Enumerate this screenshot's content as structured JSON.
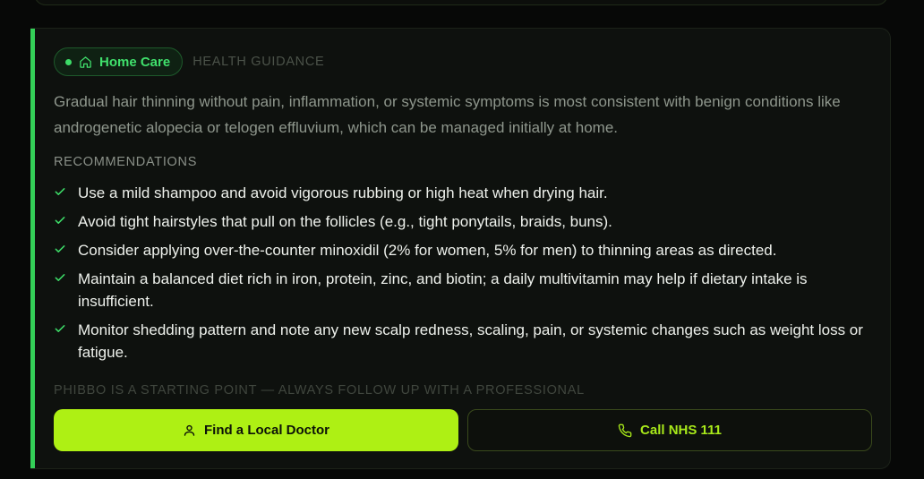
{
  "card": {
    "badge_label": "Home Care",
    "badge_icon": "home-icon",
    "eyebrow": "HEALTH GUIDANCE",
    "summary": "Gradual hair thinning without pain, inflammation, or systemic symptoms is most consistent with benign conditions like androgenetic alopecia or telogen effluvium, which can be managed initially at home.",
    "recommendations_title": "RECOMMENDATIONS",
    "recommendations": [
      "Use a mild shampoo and avoid vigorous rubbing or high heat when drying hair.",
      "Avoid tight hairstyles that pull on the follicles (e.g., tight ponytails, braids, buns).",
      "Consider applying over-the-counter minoxidil (2% for women, 5% for men) to thinning areas as directed.",
      "Maintain a balanced diet rich in iron, protein, zinc, and biotin; a daily multivitamin may help if dietary intake is insufficient.",
      "Monitor shedding pattern and note any new scalp redness, scaling, pain, or systemic changes such as weight loss or fatigue."
    ],
    "disclaimer": "PHIBBO IS A STARTING POINT — ALWAYS FOLLOW UP WITH A PROFESSIONAL",
    "primary_button": {
      "label": "Find a Local Doctor",
      "icon": "user-icon"
    },
    "secondary_button": {
      "label": "Call NHS 111",
      "icon": "phone-icon"
    }
  },
  "colors": {
    "accent": "#34d058",
    "badge_text": "#40e06c",
    "primary_button_bg": "#aef014",
    "secondary_button_text": "#a8e91a",
    "background": "#070807"
  }
}
